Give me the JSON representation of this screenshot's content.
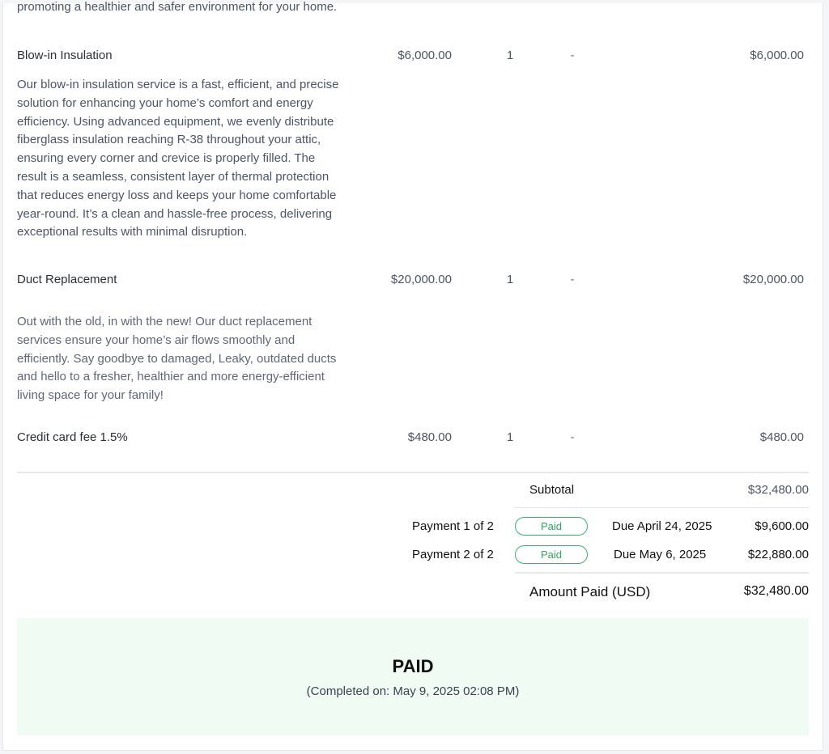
{
  "items": [
    {
      "name": "",
      "description": "promoting a healthier and safer environment for your home."
    },
    {
      "name": "Blow-in Insulation",
      "price": "$6,000.00",
      "qty": "1",
      "discount": "-",
      "total": "$6,000.00",
      "description": "Our blow-in insulation service is a fast, efficient, and precise solution for enhancing your home’s comfort and energy efficiency. Using advanced equipment, we evenly distribute fiberglass insulation reaching R-38 throughout your attic, ensuring every corner and crevice is properly filled. The result is a seamless, consistent layer of thermal protection that reduces energy loss and keeps your home comfortable year-round. It’s a clean and hassle-free process, delivering exceptional results with minimal disruption."
    },
    {
      "name": "Duct Replacement",
      "price": "$20,000.00",
      "qty": "1",
      "discount": "-",
      "total": "$20,000.00",
      "description": "Out with the old, in with the new! Our duct replacement services ensure your home’s air flows smoothly and efficiently. Say goodbye to damaged, Leaky, outdated ducts and hello to a fresher, healthier and more energy-efficient living space for your family!"
    },
    {
      "name": "Credit card fee 1.5%",
      "price": "$480.00",
      "qty": "1",
      "discount": "-",
      "total": "$480.00"
    }
  ],
  "summary": {
    "subtotal_label": "Subtotal",
    "subtotal_value": "$32,480.00",
    "payments": [
      {
        "label": "Payment 1 of 2",
        "status": "Paid",
        "due": "Due April 24, 2025",
        "amount": "$9,600.00"
      },
      {
        "label": "Payment 2 of 2",
        "status": "Paid",
        "due": "Due May 6, 2025",
        "amount": "$22,880.00"
      }
    ],
    "amount_paid_label": "Amount Paid (USD)",
    "amount_paid_value": "$32,480.00"
  },
  "paid_banner": {
    "title": "PAID",
    "completed": "(Completed on: May 9, 2025 02:08 PM)"
  },
  "colors": {
    "paid_green": "#2fa661",
    "paid_bg": "#f0fbf3"
  }
}
